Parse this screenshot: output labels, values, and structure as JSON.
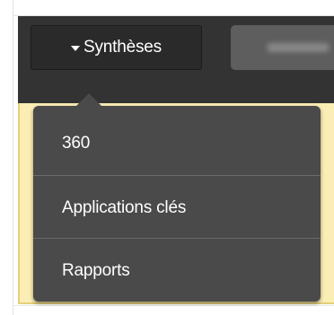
{
  "navbar": {
    "menu_button": {
      "label": "Synthèses",
      "icon": "caret-down-icon"
    },
    "blurred_tab": {
      "label": ""
    }
  },
  "dropdown": {
    "items": [
      {
        "label": "360"
      },
      {
        "label": "Applications clés"
      },
      {
        "label": "Rapports"
      }
    ]
  },
  "colors": {
    "navbar_bg": "#333333",
    "dropdown_bg": "#4a4a4a",
    "highlight_bg": "#fbeeb4",
    "text": "#ffffff"
  }
}
